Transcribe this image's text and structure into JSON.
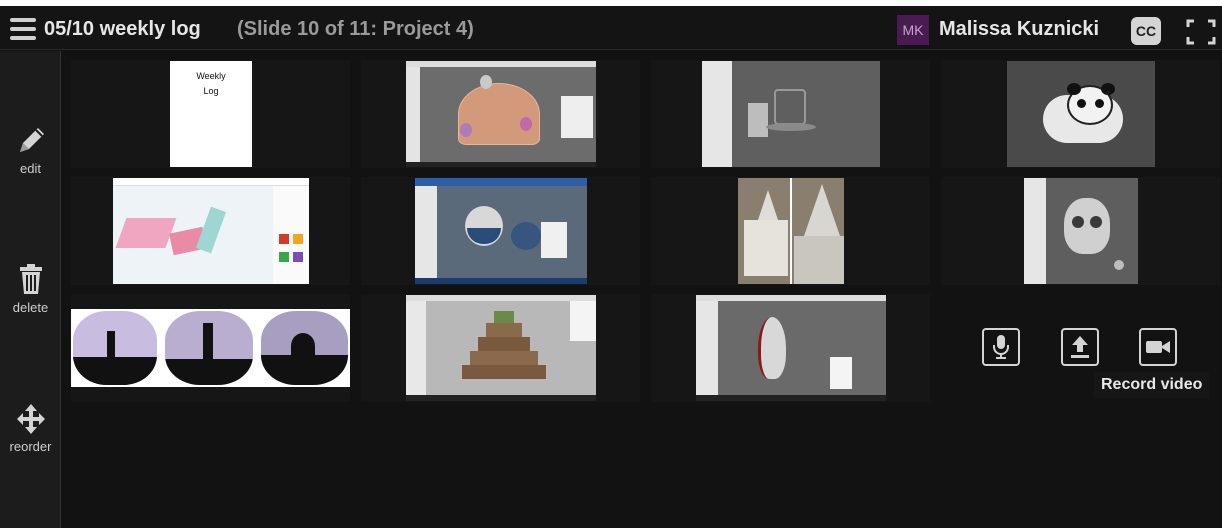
{
  "header": {
    "title": "05/10 weekly log",
    "slide_info": "(Slide 10 of 11: Project 4)",
    "user": {
      "initials": "MK",
      "name": "Malissa Kuznicki"
    },
    "cc_label": "CC"
  },
  "sidebar": {
    "tools": [
      {
        "label": "edit",
        "icon": "pencil-icon"
      },
      {
        "label": "delete",
        "icon": "trash-icon"
      },
      {
        "label": "reorder",
        "icon": "move-icon"
      }
    ]
  },
  "slides": [
    {
      "name": "weekly-log-cover",
      "text_line1": "Weekly",
      "text_line2": "Log"
    },
    {
      "name": "balloon-scene"
    },
    {
      "name": "room-model"
    },
    {
      "name": "panda-model"
    },
    {
      "name": "tinkercad-shapes"
    },
    {
      "name": "helmet-model"
    },
    {
      "name": "cone-photos"
    },
    {
      "name": "skull-model"
    },
    {
      "name": "silhouette-ornaments"
    },
    {
      "name": "pyramid-model"
    },
    {
      "name": "shell-model"
    }
  ],
  "actions": {
    "tooltip": "Record video",
    "buttons": [
      {
        "name": "record-audio-button",
        "icon": "microphone-icon"
      },
      {
        "name": "upload-button",
        "icon": "upload-icon"
      },
      {
        "name": "record-video-button",
        "icon": "video-camera-icon"
      }
    ]
  },
  "colors": {
    "accent": "#4a1a52",
    "background": "#121212",
    "sidebar": "#1c1c1c"
  }
}
